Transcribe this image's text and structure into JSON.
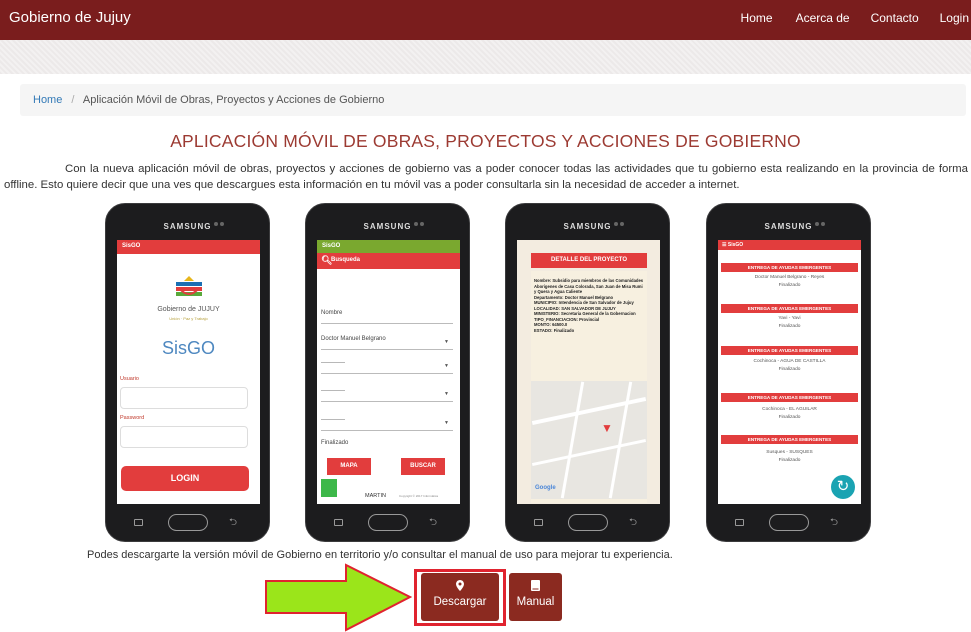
{
  "header": {
    "brand": "Gobierno de Jujuy",
    "nav": {
      "home": "Home",
      "about": "Acerca de",
      "contact": "Contacto",
      "login": "Login"
    }
  },
  "breadcrumb": {
    "home": "Home",
    "separator": "/",
    "current": "Aplicación Móvil de Obras, Proyectos y Acciones de Gobierno"
  },
  "main": {
    "title": "APLICACIÓN MÓVIL DE OBRAS, PROYECTOS Y ACCIONES DE GOBIERNO",
    "intro": "Con la nueva aplicación móvil de obras, proyectos y acciones de gobierno vas a poder conocer todas las actividades que tu gobierno esta realizando en la provincia de forma offline. Esto quiere decir que una ves que descargues esta información en tu móvil vas a poder consultarla sin la necesidad de acceder a internet.",
    "download_text": "Podes descargarte la versión móvil de Gobierno en territorio y/o consultar el manual de uso para mejorar tu experiencia."
  },
  "phones": {
    "brand": "SAMSUNG",
    "login": {
      "app_bar": "SisGO",
      "gov_name": "Gobierno de JUJUY",
      "gov_tagline": "Unión · Paz y Trabajo",
      "app_name": "SisGO",
      "user_label": "Usuario",
      "password_label": "Password",
      "login_button": "LOGIN"
    },
    "search": {
      "app_bar": "SisGO",
      "search_title": "Busqueda",
      "name_field": "Nombre",
      "name_value": "Doctor Manuel Belgrano",
      "select_placeholder": "------------",
      "status_value": "Finalizado",
      "map_button": "MAPA",
      "search_button": "BUSCAR",
      "user_name": "MARTIN",
      "copyright": "Copyright © 2017 Informática"
    },
    "detail": {
      "title": "DETALLE DEL PROYECTO",
      "lines": [
        "Nombre: Subsidio para miembros de las Comunidades Aborigenes de Casa Colorada, San Juan de Misa Rumi y Quera y Agua Caliente",
        "Departamento: Doctor Manuel Belgrano",
        "MUNICIPIO: Intendencia de San Salvador de Jujuy",
        "LOCALIDAD: SAN SALVADOR DE JUJUY",
        "MINISTERIO: Secretaria General de la Gobernacion",
        "TIPO_FINANCIACION: Provincial",
        "MONTO: 64500.0",
        "ESTADO: Finalizado"
      ],
      "map_logo": "Google"
    },
    "list": {
      "app_bar": "SisGO",
      "entries": [
        {
          "heading": "ENTREGA DE AYUDAS EMERGENTES",
          "place": "Doctor Manuel Belgrano - Reyes",
          "status": "Finalizado"
        },
        {
          "heading": "ENTREGA DE AYUDAS EMERGENTES",
          "place": "Yavi - Yavi",
          "status": "Finalizado"
        },
        {
          "heading": "ENTREGA DE AYUDAS EMERGENTES",
          "place": "Cochinoca - AGUA DE CASTILLA",
          "status": "Finalizado"
        },
        {
          "heading": "ENTREGA DE AYUDAS EMERGENTES",
          "place": "Cochinoca - EL AGUILAR",
          "status": "Finalizado"
        },
        {
          "heading": "ENTREGA DE AYUDAS EMERGENTES",
          "place": "Susques - SUSQUES",
          "status": "Finalizado"
        }
      ]
    }
  },
  "buttons": {
    "download": {
      "label": "Descargar",
      "icon": "map-marker-icon"
    },
    "manual": {
      "label": "Manual",
      "icon": "book-icon"
    }
  },
  "colors": {
    "navbar": "#7a1d1d",
    "title": "#9c3a32",
    "button": "#8b2a20",
    "highlight": "#e0232f",
    "arrow": "#9be51a",
    "app_red": "#e23d3d",
    "app_green": "#7aa82f"
  }
}
